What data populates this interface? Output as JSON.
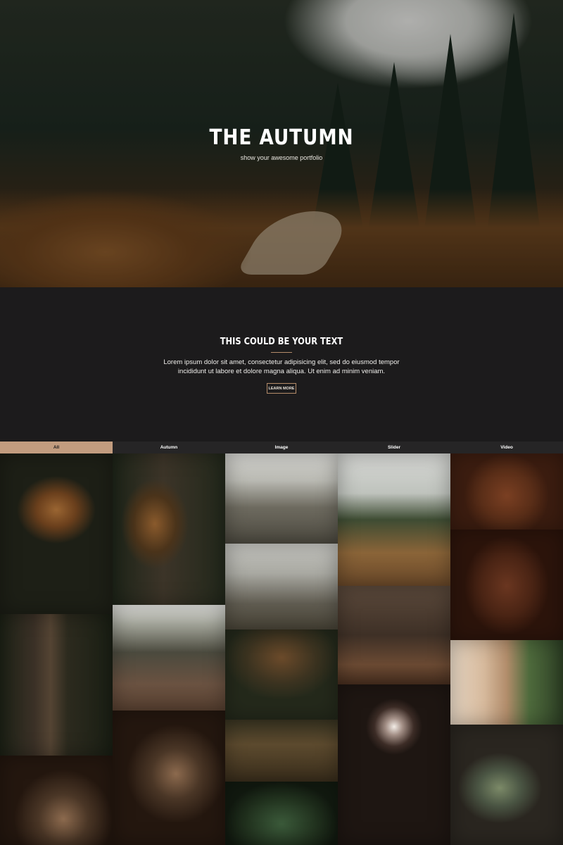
{
  "hero": {
    "title": "THE AUTUMN",
    "subtitle": "show your awesome portfolio"
  },
  "intro": {
    "heading": "THIS COULD BE YOUR TEXT",
    "body": "Lorem ipsum dolor sit amet, consectetur adipisicing elit, sed do eiusmod tempor incididunt ut labore et dolore magna aliqua. Ut enim ad minim veniam.",
    "button_label": "LEARN MORE"
  },
  "filter_tabs": [
    {
      "label": "All",
      "active": true
    },
    {
      "label": "Autumn",
      "active": false
    },
    {
      "label": "Image",
      "active": false
    },
    {
      "label": "Slider",
      "active": false
    },
    {
      "label": "Video",
      "active": false
    }
  ],
  "colors": {
    "accent": "#c29c7f",
    "background": "#1c1b1c",
    "tab_bar": "#262526"
  }
}
